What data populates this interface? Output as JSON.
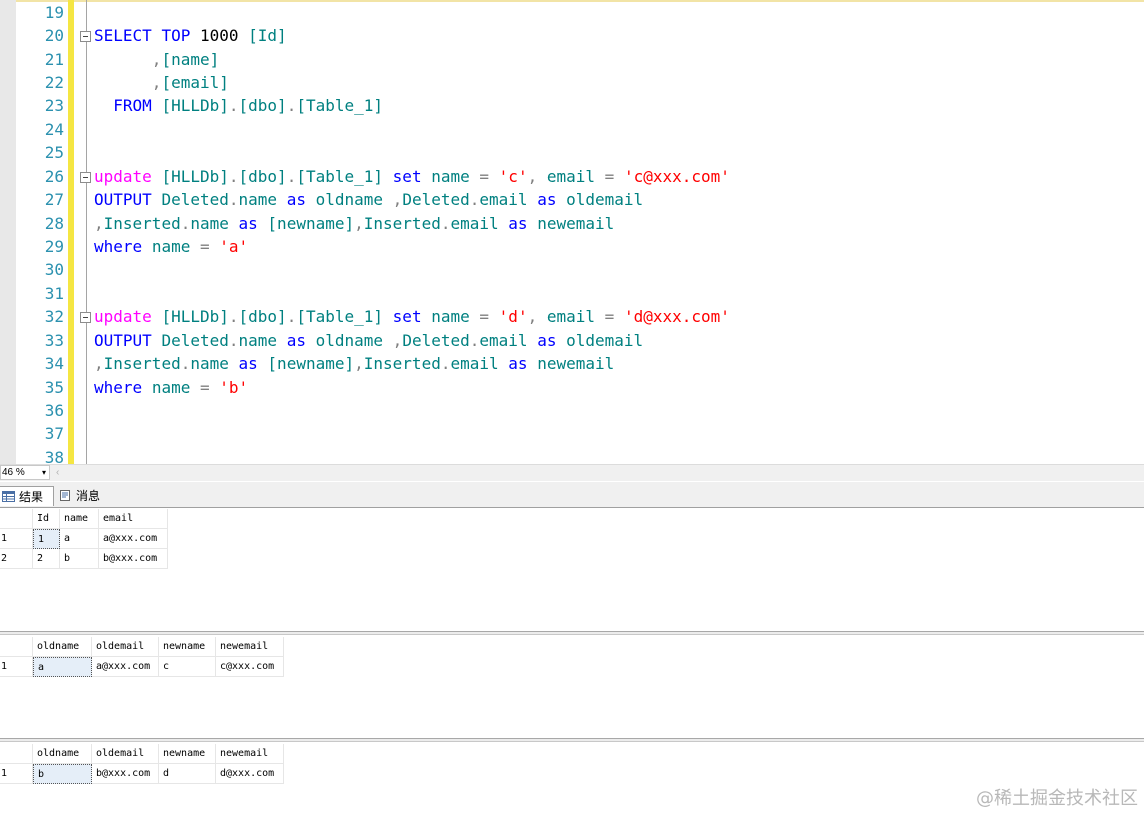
{
  "editor": {
    "line_numbers": [
      "19",
      "20",
      "21",
      "22",
      "23",
      "24",
      "25",
      "26",
      "27",
      "28",
      "29",
      "30",
      "31",
      "32",
      "33",
      "34",
      "35",
      "36",
      "37",
      "38"
    ]
  },
  "code": {
    "l20": {
      "select": "SELECT",
      "top": "TOP",
      "n1000": "1000",
      "id": "[Id]"
    },
    "l21": {
      "comma": ",",
      "name": "[name]"
    },
    "l22": {
      "comma": ",",
      "email": "[email]"
    },
    "l23": {
      "from": "FROM",
      "db": "[HLLDb]",
      "dot1": ".",
      "dbo": "[dbo]",
      "dot2": ".",
      "table": "[Table_1]"
    },
    "l26": {
      "update": "update",
      "db": "[HLLDb]",
      "dot1": ".",
      "dbo": "[dbo]",
      "dot2": ".",
      "table": "[Table_1]",
      "set": "set",
      "name": "name",
      "eq1": "=",
      "val1": "'c'",
      "comma": ",",
      "email": "email",
      "eq2": "=",
      "val2": "'c@xxx.com'"
    },
    "l27": {
      "output": "OUTPUT",
      "deleted1": "Deleted",
      "dot1": ".",
      "name": "name",
      "as1": "as",
      "oldname": "oldname",
      "comma": ",",
      "deleted2": "Deleted",
      "dot2": ".",
      "email": "email",
      "as2": "as",
      "oldemail": "oldemail"
    },
    "l28": {
      "comma1": ",",
      "inserted1": "Inserted",
      "dot1": ".",
      "name": "name",
      "as1": "as",
      "newname": "[newname]",
      "comma2": ",",
      "inserted2": "Inserted",
      "dot2": ".",
      "email": "email",
      "as2": "as",
      "newemail": "newemail"
    },
    "l29": {
      "where": "where",
      "name": "name",
      "eq": "=",
      "val": "'a'"
    },
    "l32": {
      "update": "update",
      "db": "[HLLDb]",
      "dot1": ".",
      "dbo": "[dbo]",
      "dot2": ".",
      "table": "[Table_1]",
      "set": "set",
      "name": "name",
      "eq1": "=",
      "val1": "'d'",
      "comma": ",",
      "email": "email",
      "eq2": "=",
      "val2": "'d@xxx.com'"
    },
    "l33": {
      "output": "OUTPUT",
      "deleted1": "Deleted",
      "dot1": ".",
      "name": "name",
      "as1": "as",
      "oldname": "oldname",
      "comma": ",",
      "deleted2": "Deleted",
      "dot2": ".",
      "email": "email",
      "as2": "as",
      "oldemail": "oldemail"
    },
    "l34": {
      "comma1": ",",
      "inserted1": "Inserted",
      "dot1": ".",
      "name": "name",
      "as1": "as",
      "newname": "[newname]",
      "comma2": ",",
      "inserted2": "Inserted",
      "dot2": ".",
      "email": "email",
      "as2": "as",
      "newemail": "newemail"
    },
    "l35": {
      "where": "where",
      "name": "name",
      "eq": "=",
      "val": "'b'"
    }
  },
  "zoom": {
    "value": "46 %",
    "arrow": "▾",
    "scroll_left": "‹"
  },
  "tabs": {
    "results": "结果",
    "messages": "消息"
  },
  "grid1": {
    "headers": [
      "Id",
      "name",
      "email"
    ],
    "rows": [
      [
        "1",
        "1",
        "a",
        "a@xxx.com"
      ],
      [
        "2",
        "2",
        "b",
        "b@xxx.com"
      ]
    ]
  },
  "grid2": {
    "headers": [
      "oldname",
      "oldemail",
      "newname",
      "newemail"
    ],
    "rows": [
      [
        "1",
        "a",
        "a@xxx.com",
        "c",
        "c@xxx.com"
      ]
    ]
  },
  "grid3": {
    "headers": [
      "oldname",
      "oldemail",
      "newname",
      "newemail"
    ],
    "rows": [
      [
        "1",
        "b",
        "b@xxx.com",
        "d",
        "d@xxx.com"
      ]
    ]
  },
  "watermark": "@稀土掘金技术社区",
  "colors": {
    "keyword": "#0000ff",
    "function": "#ff00ff",
    "identifier": "#008080",
    "string": "#ff0000",
    "operator": "#808080",
    "line_number": "#2b91af",
    "change_bar": "#f5e642"
  }
}
